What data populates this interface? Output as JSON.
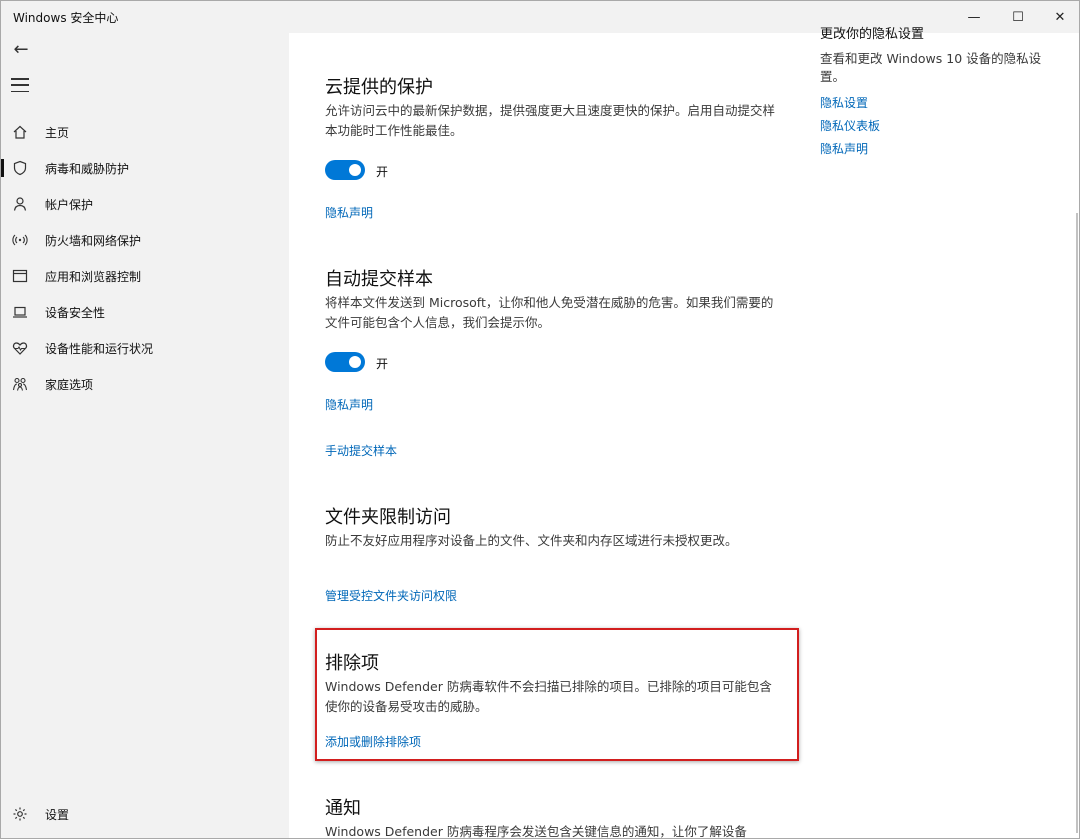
{
  "window": {
    "title": "Windows 安全中心",
    "minimize": "—",
    "maximize": "☐",
    "close": "✕"
  },
  "sidebar": {
    "back": "←",
    "items": [
      {
        "label": "主页",
        "icon": "home-icon"
      },
      {
        "label": "病毒和威胁防护",
        "icon": "shield-icon",
        "active": true
      },
      {
        "label": "帐户保护",
        "icon": "person-icon"
      },
      {
        "label": "防火墙和网络保护",
        "icon": "wifi-icon"
      },
      {
        "label": "应用和浏览器控制",
        "icon": "browser-icon"
      },
      {
        "label": "设备安全性",
        "icon": "laptop-icon"
      },
      {
        "label": "设备性能和运行状况",
        "icon": "heart-icon"
      },
      {
        "label": "家庭选项",
        "icon": "family-icon"
      }
    ],
    "settings_label": "设置"
  },
  "cloud": {
    "title": "云提供的保护",
    "desc": "允许访问云中的最新保护数据，提供强度更大且速度更快的保护。启用自动提交样本功能时工作性能最佳。",
    "toggle_label": "开",
    "privacy_link": "隐私声明"
  },
  "sample": {
    "title": "自动提交样本",
    "desc": "将样本文件发送到 Microsoft，让你和他人免受潜在威胁的危害。如果我们需要的文件可能包含个人信息，我们会提示你。",
    "toggle_label": "开",
    "privacy_link": "隐私声明",
    "manual_link": "手动提交样本"
  },
  "folder": {
    "title": "文件夹限制访问",
    "desc": "防止不友好应用程序对设备上的文件、文件夹和内存区域进行未授权更改。",
    "link": "管理受控文件夹访问权限"
  },
  "exclusions": {
    "title": "排除项",
    "desc": "Windows Defender 防病毒软件不会扫描已排除的项目。已排除的项目可能包含使你的设备易受攻击的威胁。",
    "link": "添加或删除排除项"
  },
  "notify": {
    "title": "通知",
    "desc": "Windows Defender 防病毒程序会发送包含关键信息的通知，让你了解设备"
  },
  "right": {
    "heading": "更改你的隐私设置",
    "desc": "查看和更改 Windows 10 设备的隐私设置。",
    "links": [
      "隐私设置",
      "隐私仪表板",
      "隐私声明"
    ]
  },
  "colors": {
    "accent": "#0078d7",
    "link": "#0067b8",
    "highlight": "#d21e1e",
    "sidebar_bg": "#f2f2f2"
  }
}
